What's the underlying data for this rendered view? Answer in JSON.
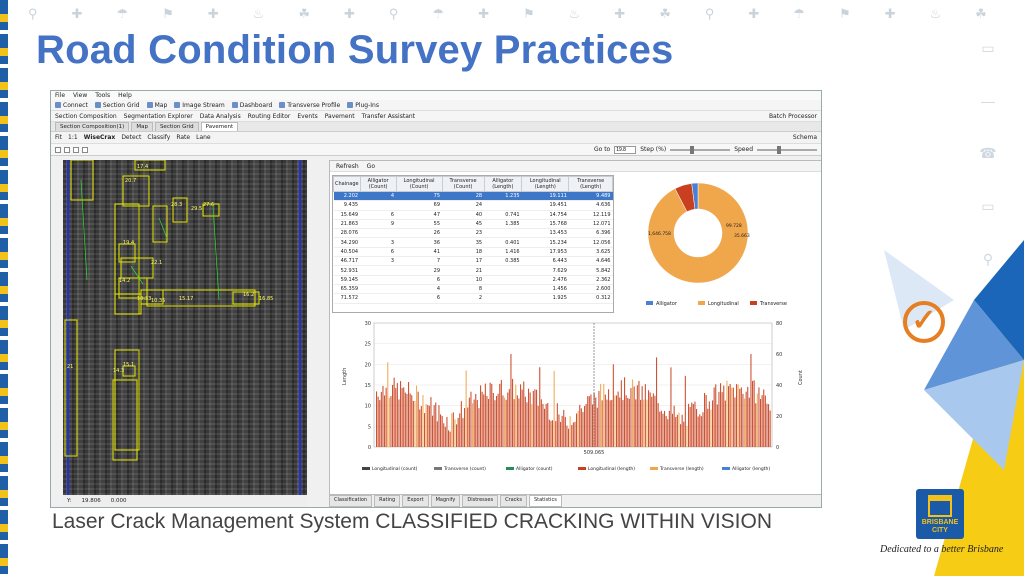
{
  "slide": {
    "title": "Road Condition Survey  Practices",
    "subtitle": "Laser Crack Management System CLASSIFIED CRACKING WITHIN VISION",
    "tagline": "Dedicated to a better Brisbane",
    "logo_text": "BRISBANE CITY"
  },
  "app": {
    "menu": [
      "File",
      "View",
      "Tools",
      "Help"
    ],
    "toolbar1": [
      "Connect",
      "Section Grid",
      "Map",
      "Image Stream",
      "Dashboard",
      "Transverse Profile",
      "Plug-Ins"
    ],
    "toolbar2": [
      "Section Composition",
      "Segmentation Explorer",
      "Data Analysis",
      "Routing Editor",
      "Events",
      "Pavement",
      "Transfer Assistant"
    ],
    "batch_processor": "Batch Processor",
    "tabs": [
      "Section Composition(1)",
      "Map",
      "Section Grid",
      "Pavement"
    ],
    "active_tab": "Pavement",
    "strip": {
      "fit": "Fit",
      "ratio": "1:1",
      "wisecrax": "WiseCrax",
      "detect": "Detect",
      "classify": "Classify",
      "rate": "Rate",
      "lane": "Lane",
      "schema": "Schema"
    },
    "goto": {
      "label": "Go to",
      "value": "19.8",
      "step_label": "Step (%)",
      "speed_label": "Speed"
    },
    "status": {
      "y_label": "Y:",
      "y_value": "19.806",
      "x_value": "0.000"
    },
    "crack_labels": [
      "17.4",
      "20.7",
      "28.3",
      "29.5",
      "27.6",
      "19.4",
      "22.1",
      "14.2",
      "10.33",
      "10.35",
      "15.17",
      "16.2",
      "16.85",
      "21",
      "14.3",
      "15.1"
    ],
    "panel": {
      "refresh": "Refresh",
      "go": "Go"
    },
    "table": {
      "headers": [
        "Chainage",
        "Alligator (Count)",
        "Longitudinal (Count)",
        "Transverse (Count)",
        "Alligator (Length)",
        "Longitudinal (Length)",
        "Transverse (Length)"
      ],
      "rows": [
        [
          "2.202",
          "4",
          "75",
          "28",
          "1.235",
          "19.111",
          "9.489"
        ],
        [
          "9.435",
          "",
          "69",
          "24",
          "",
          "19.451",
          "4.636"
        ],
        [
          "15.649",
          "6",
          "47",
          "40",
          "0.741",
          "14.754",
          "12.119"
        ],
        [
          "21.863",
          "9",
          "55",
          "45",
          "1.385",
          "15.768",
          "12.071"
        ],
        [
          "28.076",
          "",
          "26",
          "23",
          "",
          "13.453",
          "6.396"
        ],
        [
          "34.290",
          "3",
          "36",
          "35",
          "0.401",
          "15.234",
          "12.056"
        ],
        [
          "40.504",
          "6",
          "41",
          "18",
          "1.416",
          "17.953",
          "3.625"
        ],
        [
          "46.717",
          "3",
          "7",
          "17",
          "0.385",
          "6.443",
          "4.646"
        ],
        [
          "52.931",
          "",
          "29",
          "21",
          "",
          "7.629",
          "5.842"
        ],
        [
          "59.145",
          "",
          "6",
          "10",
          "",
          "2.476",
          "2.362"
        ],
        [
          "65.359",
          "",
          "4",
          "8",
          "",
          "1.456",
          "2.600"
        ],
        [
          "71.572",
          "",
          "6",
          "2",
          "",
          "1.925",
          "0.312"
        ]
      ]
    },
    "donut": {
      "labels": [
        "1,646.758",
        "99.728",
        "35.663"
      ],
      "legend": [
        "Alligator",
        "Longitudinal",
        "Transverse"
      ],
      "colors": [
        "#4a7fd4",
        "#f0a64a",
        "#c8401f"
      ]
    },
    "line_chart": {
      "y_left_ticks": [
        "30",
        "25",
        "20",
        "15",
        "10",
        "5",
        "0"
      ],
      "y_right_ticks": [
        "80",
        "60",
        "40",
        "20",
        "0"
      ],
      "y_left_label": "Length",
      "y_right_label": "Count",
      "marker_label": "509.065",
      "legend": [
        "Longitudinal (count)",
        "Transverse (count)",
        "Alligator (count)",
        "Longitudinal (length)",
        "Transverse (length)",
        "Alligator (length)"
      ]
    },
    "bottom_tabs": [
      "Classification",
      "Rating",
      "Export",
      "Magnify",
      "Distresses",
      "Cracks",
      "Statistics"
    ]
  }
}
